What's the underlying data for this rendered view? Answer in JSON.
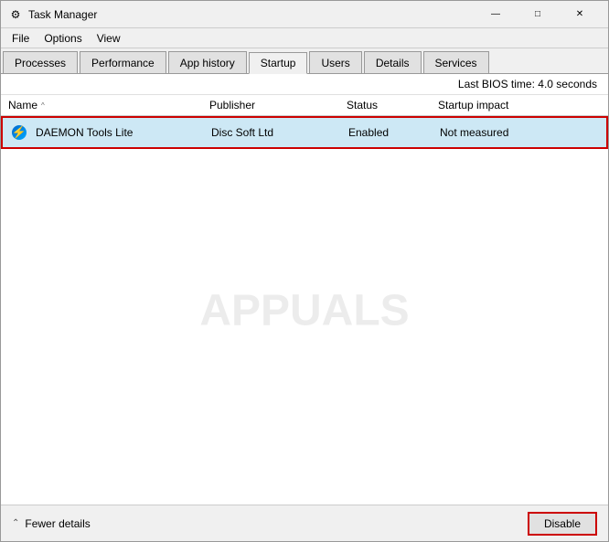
{
  "window": {
    "title": "Task Manager",
    "title_icon": "⚙"
  },
  "title_bar_buttons": {
    "minimize": "—",
    "maximize": "□",
    "close": "✕"
  },
  "menu": {
    "items": [
      "File",
      "Options",
      "View"
    ]
  },
  "tabs": [
    {
      "label": "Processes",
      "active": false
    },
    {
      "label": "Performance",
      "active": false
    },
    {
      "label": "App history",
      "active": false
    },
    {
      "label": "Startup",
      "active": true
    },
    {
      "label": "Users",
      "active": false
    },
    {
      "label": "Details",
      "active": false
    },
    {
      "label": "Services",
      "active": false
    }
  ],
  "bios_time": {
    "label": "Last BIOS time:",
    "value": "4.0 seconds"
  },
  "columns": {
    "name": "Name",
    "publisher": "Publisher",
    "status": "Status",
    "impact": "Startup impact",
    "sort_indicator": "^"
  },
  "rows": [
    {
      "name": "DAEMON Tools Lite",
      "publisher": "Disc Soft Ltd",
      "status": "Enabled",
      "impact": "Not measured",
      "selected": true
    }
  ],
  "footer": {
    "fewer_details_label": "Fewer details",
    "disable_button_label": "Disable"
  },
  "watermark": "APPUALS"
}
